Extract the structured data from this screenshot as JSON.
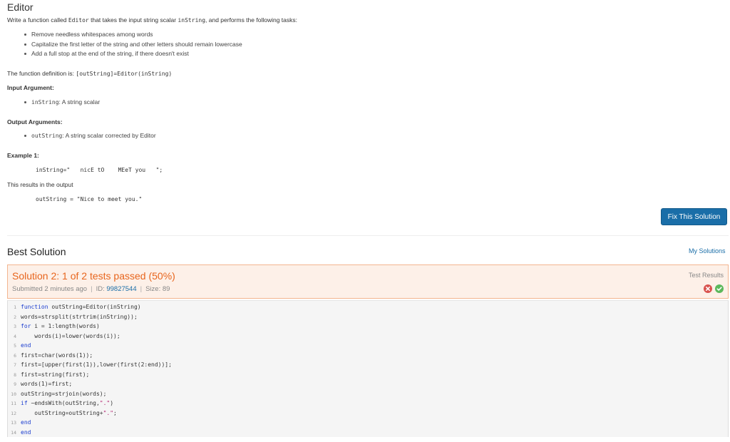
{
  "problem": {
    "title": "Editor",
    "intro": {
      "part1": "Write a function called ",
      "func_name": "Editor",
      "part2": " that takes the input string scalar ",
      "arg_name": "inString",
      "part3": ", and performs the following tasks:"
    },
    "tasks": [
      "Remove needless whitespaces among words",
      "Capitalize the first letter of the string and other letters should remain lowercase",
      "Add a full stop at the end of the string, if there doesn't exist"
    ],
    "definition": {
      "label": "The function definition is: ",
      "code": "[outString]=Editor(inString)"
    },
    "input_heading": "Input Argument:",
    "input_arg": {
      "name": "inString",
      "desc": ": A string scalar"
    },
    "output_heading": "Output Arguments:",
    "output_arg": {
      "name": "outString",
      "desc": ": A string scalar corrected by Editor"
    },
    "example_heading": "Example 1:",
    "example_input": "inString=\"   nicE tO    MEeT you   \";",
    "result_text": "This results in the output",
    "example_output": "outString = \"Nice to meet you.\""
  },
  "fix_button_label": "Fix This Solution",
  "best": {
    "title": "Best Solution",
    "my_solutions_link": "My Solutions"
  },
  "solution": {
    "title": "Solution 2: 1 of 2 tests passed (50%)",
    "submitted": "Submitted 2 minutes ago",
    "id_label": "ID: ",
    "id_value": "99827544",
    "size": "Size: 89",
    "test_results_label": "Test Results",
    "test_status": [
      "fail",
      "pass"
    ],
    "colors": {
      "fail": "#d9534f",
      "pass": "#5cb85c",
      "accent": "#e8651d"
    }
  },
  "code_lines": [
    {
      "n": "1",
      "kw": "function",
      "rest": " outString=Editor(inString)"
    },
    {
      "n": "2",
      "kw": "",
      "rest": "words=strsplit(strtrim(inString));"
    },
    {
      "n": "3",
      "kw": "for",
      "rest": " i = 1:length(words)"
    },
    {
      "n": "4",
      "kw": "",
      "rest": "    words(i)=lower(words(i));"
    },
    {
      "n": "5",
      "kw": "end",
      "rest": ""
    },
    {
      "n": "6",
      "kw": "",
      "rest": "first=char(words(1));"
    },
    {
      "n": "7",
      "kw": "",
      "rest": "first=[upper(first(1)),lower(first(2:end))];"
    },
    {
      "n": "8",
      "kw": "",
      "rest": "first=string(first);"
    },
    {
      "n": "9",
      "kw": "",
      "rest": "words(1)=first;"
    },
    {
      "n": "10",
      "kw": "",
      "rest": "outString=strjoin(words);"
    },
    {
      "n": "11",
      "kw": "if",
      "rest": " ~endsWith(outString,\".\")"
    },
    {
      "n": "12",
      "kw": "",
      "rest": "    outString=outString+\".\";"
    },
    {
      "n": "13",
      "kw": "end",
      "rest": ""
    },
    {
      "n": "14",
      "kw": "end",
      "rest": ""
    }
  ]
}
